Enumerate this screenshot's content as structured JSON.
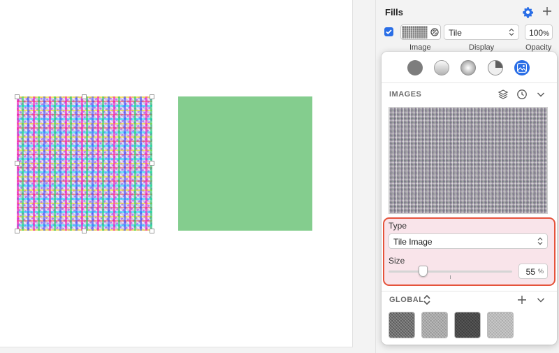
{
  "inspector": {
    "fills_title": "Fills",
    "fill": {
      "display_value": "Tile",
      "opacity_value": "100",
      "opacity_unit": "%",
      "labels": {
        "image": "Image",
        "display": "Display",
        "opacity": "Opacity"
      },
      "enabled": true
    }
  },
  "popover": {
    "fill_types": [
      "solid-fill",
      "linear-gradient",
      "radial-gradient",
      "angular-gradient",
      "image-fill"
    ],
    "selected_fill_type": "image-fill",
    "images_section": {
      "label": "IMAGES"
    },
    "type": {
      "label": "Type",
      "value": "Tile Image"
    },
    "size": {
      "label": "Size",
      "value": "55",
      "unit": "%",
      "slider_fraction": 0.28
    },
    "global_section": {
      "label": "GLOBAL"
    }
  },
  "colors": {
    "accent": "#2a6ee6",
    "highlight_border": "#e5533b",
    "highlight_fill": "#f9e4ea",
    "green_shape": "#84cd8e"
  }
}
